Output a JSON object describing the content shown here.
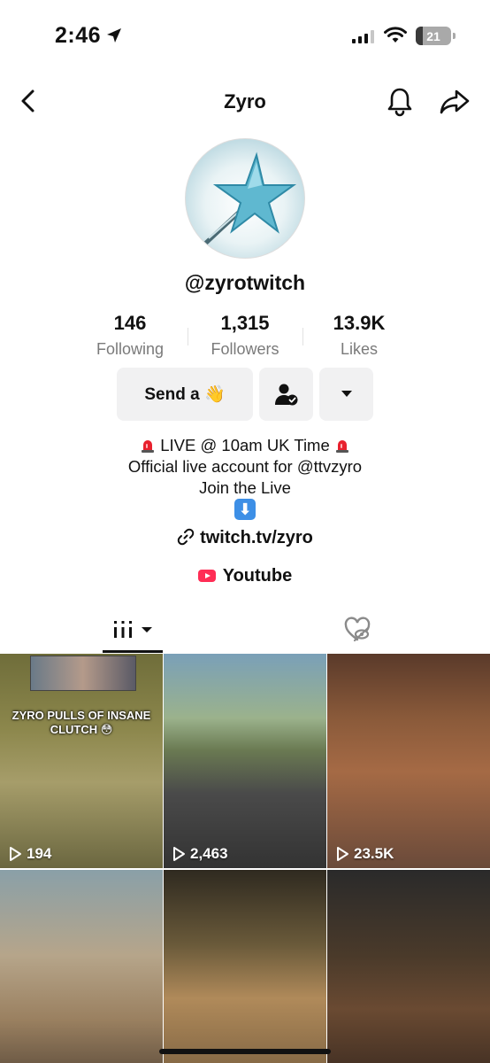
{
  "status_bar": {
    "time": "2:46",
    "battery": "21",
    "battery_level": 0.21
  },
  "header": {
    "title": "Zyro"
  },
  "profile": {
    "username": "@zyrotwitch",
    "stats": [
      {
        "value": "146",
        "label": "Following"
      },
      {
        "value": "1,315",
        "label": "Followers"
      },
      {
        "value": "13.9K",
        "label": "Likes"
      }
    ],
    "send_button_label": "Send a 👋"
  },
  "bio": {
    "line1": "LIVE @ 10am UK Time",
    "line2": "Official live account for @ttvzyro",
    "line3": "Join the Live",
    "arrow": "⬇"
  },
  "links": {
    "website": "twitch.tv/zyro",
    "youtube": "Youtube"
  },
  "videos": [
    {
      "views": "194",
      "overlay": "ZYRO PULLS OF INSANE CLUTCH 😳"
    },
    {
      "views": "2,463"
    },
    {
      "views": "23.5K"
    },
    {
      "views": ""
    },
    {
      "views": ""
    },
    {
      "views": ""
    }
  ],
  "icons": {
    "location": "location-arrow-icon",
    "back": "chevron-left-icon",
    "bell": "bell-icon",
    "share": "share-icon",
    "follow": "user-check-icon",
    "more": "caret-down-icon",
    "link": "link-icon",
    "videos_tab": "grid-icon",
    "liked_tab": "heart-eye-slash-icon"
  },
  "colors": {
    "youtube": "#ff2d55",
    "button_bg": "#f1f1f2",
    "muted_text": "#7a7a7a"
  }
}
